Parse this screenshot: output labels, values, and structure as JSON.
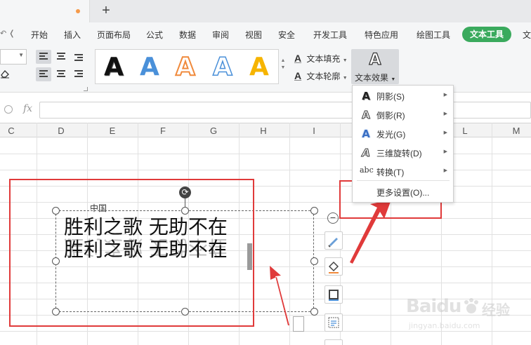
{
  "titlebar": {
    "new_tab_symbol": "+"
  },
  "menubar": {
    "nav_arrows": "↶ ❬",
    "items": [
      "开始",
      "插入",
      "页面布局",
      "公式",
      "数据",
      "审阅",
      "视图",
      "安全",
      "开发工具",
      "特色应用",
      "绘图工具",
      "文本工具",
      "文"
    ],
    "active_item": "文本工具",
    "active_color": "#3aaa5d"
  },
  "ribbon": {
    "gallery_letter": "A",
    "gallery_styles": [
      "black-fill",
      "blue-fill",
      "orange-outline",
      "blue-outline",
      "gold-fill"
    ],
    "text_fill": "文本填充",
    "text_outline": "文本轮廓",
    "text_effect": "文本效果",
    "effect_letter": "A"
  },
  "formula_bar": {
    "fx": "fx",
    "value": ""
  },
  "columns": [
    "C",
    "D",
    "E",
    "F",
    "G",
    "H",
    "I",
    "L",
    "M"
  ],
  "sheet": {
    "cell_text": "中国"
  },
  "textbox": {
    "lines": [
      "胜利之歌 无助不在",
      "胜利之歌 无助不在"
    ],
    "effect": "reflection"
  },
  "effects_menu": {
    "items": [
      {
        "icon": "shadow-icon",
        "glyph": "A",
        "label": "阴影(S)"
      },
      {
        "icon": "reflection-icon",
        "glyph": "A",
        "label": "倒影(R)"
      },
      {
        "icon": "glow-icon",
        "glyph": "A",
        "label": "发光(G)"
      },
      {
        "icon": "3d-rotation-icon",
        "glyph": "A",
        "label": "三维旋转(D)"
      },
      {
        "icon": "transform-icon",
        "glyph": "abc",
        "label": "转换(T)"
      }
    ],
    "more_settings": "更多设置(O)..."
  },
  "annotations": {
    "highlight_color": "#e03a3a"
  },
  "watermark": {
    "brand": "Baidu",
    "brand_cn": "经验",
    "url": "jingyan.baidu.com"
  }
}
